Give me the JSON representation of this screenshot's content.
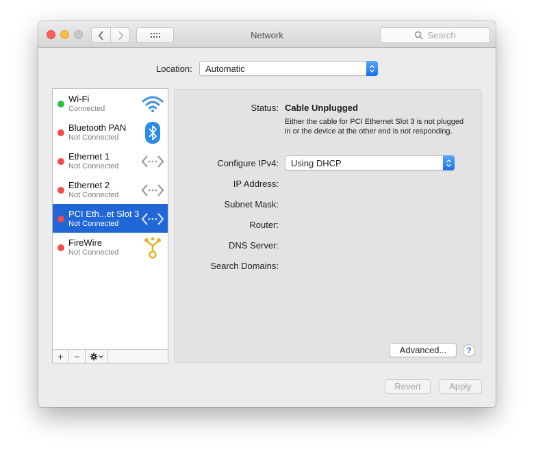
{
  "window": {
    "title": "Network"
  },
  "search": {
    "placeholder": "Search"
  },
  "location": {
    "label": "Location:",
    "value": "Automatic"
  },
  "services": [
    {
      "name": "Wi-Fi",
      "status": "Connected",
      "dot_color": "#2fc13d",
      "icon": "wifi-icon",
      "selected": false
    },
    {
      "name": "Bluetooth PAN",
      "status": "Not Connected",
      "dot_color": "#f44a4a",
      "icon": "bluetooth-icon",
      "selected": false
    },
    {
      "name": "Ethernet 1",
      "status": "Not Connected",
      "dot_color": "#f44a4a",
      "icon": "ethernet-icon",
      "selected": false
    },
    {
      "name": "Ethernet 2",
      "status": "Not Connected",
      "dot_color": "#f44a4a",
      "icon": "ethernet-icon",
      "selected": false
    },
    {
      "name": "PCI Eth...et Slot 3",
      "status": "Not Connected",
      "dot_color": "#f44a4a",
      "icon": "ethernet-icon",
      "selected": true
    },
    {
      "name": "FireWire",
      "status": "Not Connected",
      "dot_color": "#f44a4a",
      "icon": "firewire-icon",
      "selected": false
    }
  ],
  "sidebar_footer": {
    "add": "+",
    "remove": "−"
  },
  "detail": {
    "status_label": "Status:",
    "status_value": "Cable Unplugged",
    "status_description": "Either the cable for PCI Ethernet Slot 3 is not plugged in or the device at the other end is not responding.",
    "configure_label": "Configure IPv4:",
    "configure_value": "Using DHCP",
    "ip_label": "IP Address:",
    "subnet_label": "Subnet Mask:",
    "router_label": "Router:",
    "dns_label": "DNS Server:",
    "search_domains_label": "Search Domains:",
    "advanced_button": "Advanced...",
    "help_button": "?"
  },
  "actions": {
    "revert": "Revert",
    "apply": "Apply"
  },
  "colors": {
    "accent": "#2166d6",
    "connected": "#2fc13d",
    "disconnected": "#f44a4a"
  }
}
